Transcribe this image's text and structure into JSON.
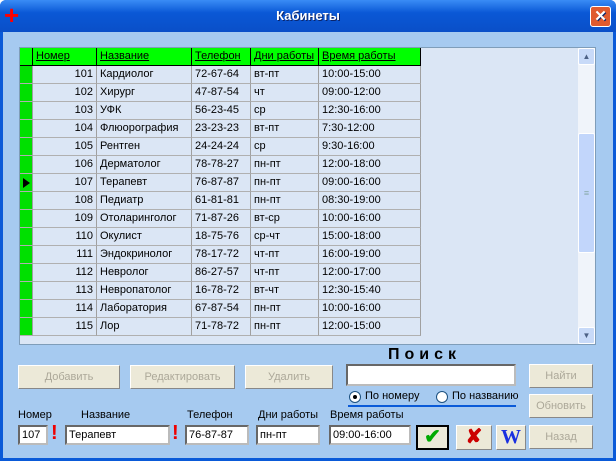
{
  "window": {
    "title": "Кабинеты"
  },
  "grid": {
    "columns": [
      "Номер",
      "Название",
      "Телефон",
      "Дни работы",
      "Время работы"
    ],
    "rows": [
      [
        "101",
        "Кардиолог",
        "72-67-64",
        "вт-пт",
        "10:00-15:00"
      ],
      [
        "102",
        "Хирург",
        "47-87-54",
        "чт",
        "09:00-12:00"
      ],
      [
        "103",
        "УФК",
        "56-23-45",
        "ср",
        "12:30-16:00"
      ],
      [
        "104",
        "Флюорография",
        "23-23-23",
        "вт-пт",
        "7:30-12:00"
      ],
      [
        "105",
        "Рентген",
        "24-24-24",
        "ср",
        "9:30-16:00"
      ],
      [
        "106",
        "Дерматолог",
        "78-78-27",
        "пн-пт",
        "12:00-18:00"
      ],
      [
        "107",
        "Терапевт",
        "76-87-87",
        "пн-пт",
        "09:00-16:00"
      ],
      [
        "108",
        "Педиатр",
        "61-81-81",
        "пн-пт",
        "08:30-19:00"
      ],
      [
        "109",
        "Отоларинголог",
        "71-87-26",
        "вт-ср",
        "10:00-16:00"
      ],
      [
        "110",
        "Окулист",
        "18-75-76",
        "ср-чт",
        "15:00-18:00"
      ],
      [
        "111",
        "Эндокринолог",
        "78-17-72",
        "чт-пт",
        "16:00-19:00"
      ],
      [
        "112",
        "Невролог",
        "86-27-57",
        "чт-пт",
        "12:00-17:00"
      ],
      [
        "113",
        "Невропатолог",
        "16-78-72",
        "вт-чт",
        "12:30-15:40"
      ],
      [
        "114",
        "Лаборатория",
        "67-87-54",
        "пн-пт",
        "10:00-16:00"
      ],
      [
        "115",
        "Лор",
        "71-78-72",
        "пн-пт",
        "12:00-15:00"
      ]
    ],
    "selected_index": 6
  },
  "buttons": {
    "add": "Добавить",
    "edit": "Редактировать",
    "delete": "Удалить",
    "find": "Найти",
    "refresh": "Обновить",
    "back": "Назад",
    "word": "W"
  },
  "search": {
    "title": "Поиск",
    "value": "",
    "by_number": "По номеру",
    "by_name": "По названию",
    "selected": "by_number"
  },
  "form": {
    "number_label": "Номер",
    "number": "107",
    "name_label": "Название",
    "name": "Терапевт",
    "phone_label": "Телефон",
    "phone": "76-87-87",
    "days_label": "Дни работы",
    "days": "пн-пт",
    "time_label": "Время работы",
    "time": "09:00-16:00",
    "required_mark": "!"
  }
}
